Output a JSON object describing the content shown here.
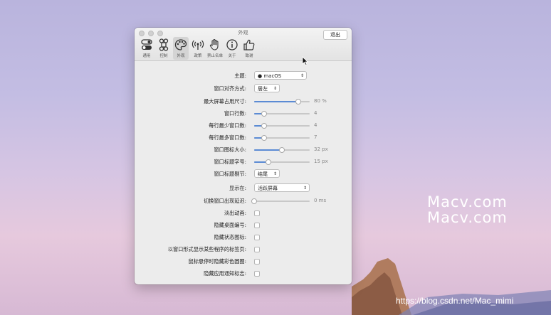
{
  "window": {
    "title": "外观",
    "quit_label": "退出"
  },
  "toolbar": [
    {
      "icon": "toggle-icon",
      "label": "通用"
    },
    {
      "icon": "command-icon",
      "label": "控制"
    },
    {
      "icon": "palette-icon",
      "label": "外观",
      "active": true
    },
    {
      "icon": "broadcast-icon",
      "label": "政策"
    },
    {
      "icon": "hand-icon",
      "label": "禁止名单"
    },
    {
      "icon": "info-icon",
      "label": "关于"
    },
    {
      "icon": "thumbs-up-icon",
      "label": "致谢"
    }
  ],
  "settings": {
    "theme": {
      "label": "主题:",
      "value": "macOS"
    },
    "align": {
      "label": "窗口对齐方式:",
      "value": "居左"
    },
    "max_size": {
      "label": "最大屏幕占用尺寸:",
      "value": "80 %",
      "fraction": 0.8
    },
    "rows": {
      "label": "窗口行数:",
      "value": "4",
      "fraction": 0.18
    },
    "min_per_row": {
      "label": "每行最少窗口数:",
      "value": "4",
      "fraction": 0.18
    },
    "max_per_row": {
      "label": "每行最多窗口数:",
      "value": "7",
      "fraction": 0.18
    },
    "icon_size": {
      "label": "窗口图标大小:",
      "value": "32 px",
      "fraction": 0.5
    },
    "title_font": {
      "label": "窗口标题字号:",
      "value": "15 px",
      "fraction": 0.25
    },
    "title_trunc": {
      "label": "窗口标题剔节:",
      "value": "结尾"
    },
    "show_on": {
      "label": "显示在:",
      "value": "活跃屏幕"
    },
    "delay": {
      "label": "切换窗口出现延迟:",
      "value": "0 ms",
      "fraction": 0.0
    },
    "fade": {
      "label": "淡出动画:"
    },
    "hide_desktop_num": {
      "label": "隐藏桌面编号:"
    },
    "hide_status_icon": {
      "label": "隐藏状态图标:"
    },
    "tabs_as_windows": {
      "label": "以窗口形式显示某些程序的标签页:"
    },
    "hide_color_circle": {
      "label": "鼠标悬停时隐藏彩色圆圈:"
    },
    "hide_app_badges": {
      "label": "隐藏应用通知标志:"
    }
  },
  "watermark": {
    "line1": "Macv.com",
    "line2": "Macv.com"
  },
  "credit": "https://blog.csdn.net/Mac_mimi"
}
